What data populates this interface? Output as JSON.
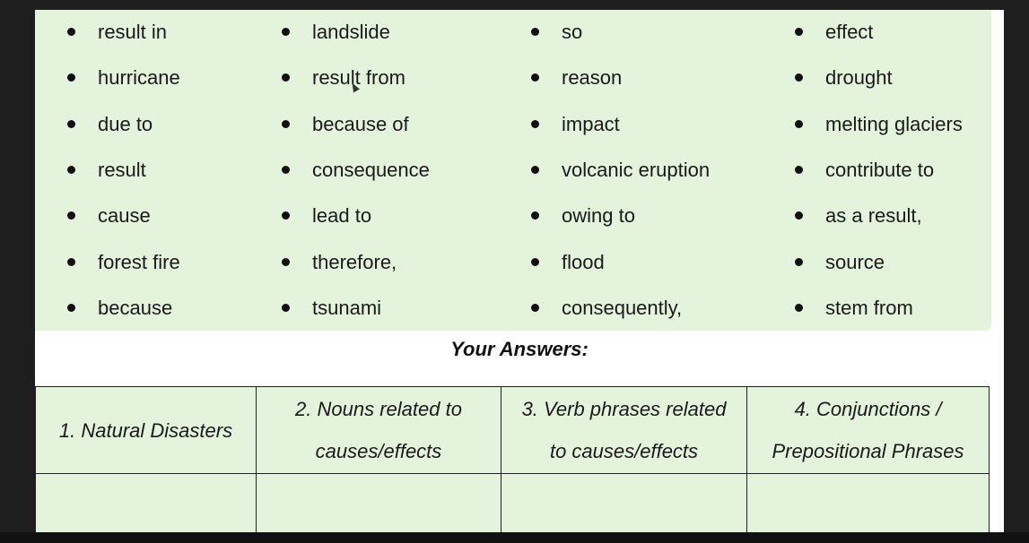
{
  "word_bank": {
    "columns": [
      [
        "result in",
        "hurricane",
        "due to",
        "result",
        "cause",
        "forest fire",
        "because"
      ],
      [
        "landslide",
        "result from",
        "because of",
        "consequence",
        "lead to",
        "therefore,",
        "tsunami"
      ],
      [
        "so",
        "reason",
        "impact",
        "volcanic eruption",
        "owing to",
        "flood",
        "consequently,"
      ],
      [
        "effect",
        "drought",
        "melting glaciers",
        "contribute to",
        "as a result,",
        "source",
        "stem from"
      ]
    ]
  },
  "answers": {
    "title": "Your Answers:",
    "headers": [
      [
        "1. Natural Disasters"
      ],
      [
        "2. Nouns related to",
        "causes/effects"
      ],
      [
        "3. Verb phrases related",
        "to causes/effects"
      ],
      [
        "4. Conjunctions /",
        "Prepositional Phrases"
      ]
    ]
  },
  "colors": {
    "panel_green": "#e3f3dc",
    "background": "#1e1e1e"
  }
}
